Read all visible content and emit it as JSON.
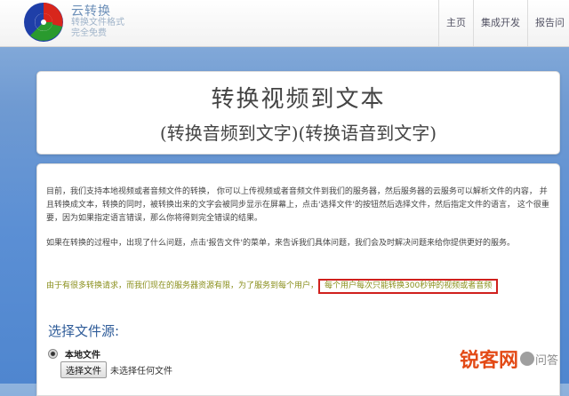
{
  "header": {
    "brand_title": "云转换",
    "brand_line1": "转换文件格式",
    "brand_line2": "完全免费",
    "nav": [
      "主页",
      "集成开发",
      "报告问"
    ]
  },
  "hero": {
    "title": "转换视频到文本",
    "subtitle": "(转换音频到文字)(转换语音到文字)"
  },
  "content": {
    "para1": "目前，我们支持本地视频或者音频文件的转换， 你可以上传视频或者音频文件到我们的服务器，然后服务器的云服务可以解析文件的内容， 并且转换成文本，转换的同时，被转换出来的文字会被同步显示在屏幕上，点击'选择文件'的按钮然后选择文件，然后指定文件的语言， 这个很重要，因为如果指定语言错误，那么你将得到完全错误的结果。",
    "para2": "如果在转换的过程中，出现了什么问题，点击'报告文件'的菜单，来告诉我们具体问题，我们会及时解决问题来给你提供更好的服务。",
    "para3_prefix": "由于有很多转换请求，而我们现在的服务器资源有限，为了服务到每个用户，",
    "para3_highlight": "每个用户每次只能转换300秒钟的视频或者音频",
    "choose_title": "选择文件源:",
    "radio_label": "本地文件",
    "file_button": "选择文件",
    "file_status": "未选择任何文件"
  },
  "watermark": {
    "text": "锐客网",
    "sub": "问答"
  },
  "colors": {
    "accent_blue": "#2f5c99",
    "notice_olive": "#8a8f1c",
    "highlight_red": "#d0201d"
  }
}
